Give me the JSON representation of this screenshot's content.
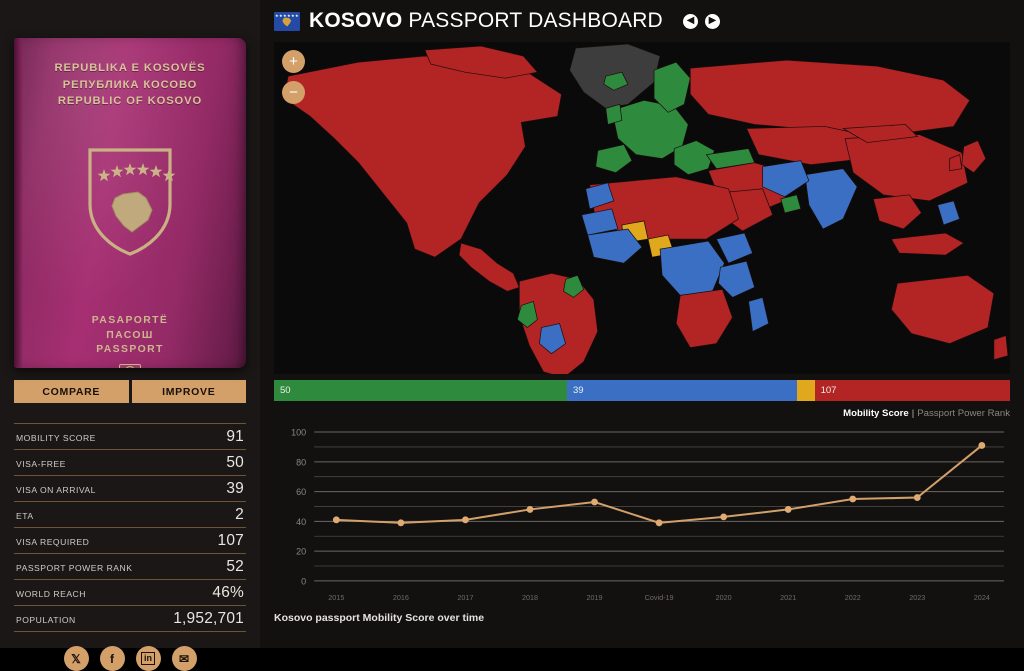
{
  "header": {
    "flag_icon": "kosovo-flag-icon",
    "title_bold": "KOSOVO",
    "title_light": " PASSPORT DASHBOARD",
    "back_icon": "◀",
    "forward_icon": "▶"
  },
  "passport": {
    "cover_lines": [
      "REPUBLIKA E KOSOVËS",
      "РЕПУБЛИКА КОСОВО",
      "REPUBLIC OF KOSOVO"
    ],
    "bottom_lines": [
      "PASAPORTË",
      "ПАСОШ",
      "PASSPORT"
    ],
    "chip_icon": "biometric-chip-icon",
    "arms_icon": "kosovo-coat-of-arms-icon",
    "cover_color": "#93295f"
  },
  "actions": {
    "compare": "COMPARE",
    "improve": "IMPROVE",
    "button_color": "#d3a06a"
  },
  "stats": [
    {
      "label": "MOBILITY SCORE",
      "value": "91"
    },
    {
      "label": "VISA-FREE",
      "value": "50"
    },
    {
      "label": "VISA ON ARRIVAL",
      "value": "39"
    },
    {
      "label": "ETA",
      "value": "2"
    },
    {
      "label": "VISA REQUIRED",
      "value": "107"
    },
    {
      "label": "PASSPORT POWER RANK",
      "value": "52"
    },
    {
      "label": "WORLD REACH",
      "value": "46%"
    },
    {
      "label": "POPULATION",
      "value": "1,952,701"
    }
  ],
  "socials": [
    {
      "name": "x-twitter-icon",
      "glyph": "𝕏"
    },
    {
      "name": "facebook-icon",
      "glyph": "f"
    },
    {
      "name": "linkedin-icon",
      "glyph": "in"
    },
    {
      "name": "email-icon",
      "glyph": "✉"
    }
  ],
  "map": {
    "zoom_in": "+",
    "zoom_out": "−",
    "colors": {
      "visa_free": "#2e8b3d",
      "visa_on_arrival": "#3a6fc4",
      "eta": "#e0a81c",
      "visa_required": "#b32424",
      "no_data": "#3d3d3d",
      "ocean": "#0a0a0a"
    }
  },
  "legend": [
    {
      "name": "visa-free",
      "value": "50",
      "color": "#2e8b3d",
      "pct": 40.3
    },
    {
      "name": "visa-on-arrival",
      "value": "39",
      "color": "#3a6fc4",
      "pct": 31.5
    },
    {
      "name": "eta",
      "value": "",
      "color": "#e0a81c",
      "pct": 1.6
    },
    {
      "name": "visa-required",
      "value": "107",
      "color": "#b32424",
      "pct": 26.6
    }
  ],
  "chart_toggle": {
    "active": "Mobility Score",
    "separator": "|",
    "inactive": "Passport Power Rank"
  },
  "caption": "Kosovo passport Mobility Score over time",
  "chart_data": {
    "type": "line",
    "title": "Kosovo passport Mobility Score over time",
    "xlabel": "",
    "ylabel": "",
    "categories": [
      "2015",
      "2016",
      "2017",
      "2018",
      "2019",
      "Covid-19",
      "2020",
      "2021",
      "2022",
      "2023",
      "2024"
    ],
    "values": [
      41,
      39,
      41,
      48,
      53,
      39,
      43,
      48,
      55,
      56,
      91
    ],
    "yticks": [
      0,
      20,
      40,
      60,
      80,
      100
    ],
    "minor_gridlines": [
      10,
      30,
      50,
      70,
      90
    ],
    "ylim": [
      0,
      100
    ],
    "grid": true,
    "legend": "none",
    "line_color": "#d3a06a",
    "marker_color": "#e0ab72",
    "series": [
      {
        "name": "Mobility Score",
        "values": [
          41,
          39,
          41,
          48,
          53,
          39,
          43,
          48,
          55,
          56,
          91
        ]
      }
    ]
  }
}
